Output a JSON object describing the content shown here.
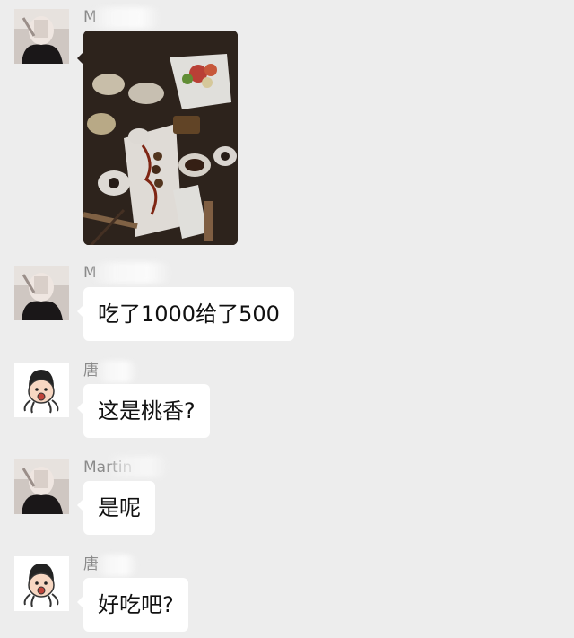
{
  "messages": [
    {
      "sender": "M",
      "type": "image",
      "image_desc": "food-photo"
    },
    {
      "sender": "M",
      "type": "text",
      "text": "吃了1000给了500"
    },
    {
      "sender": "唐",
      "type": "text",
      "text": "这是桃香?"
    },
    {
      "sender": "Martin",
      "type": "text",
      "text": "是呢"
    },
    {
      "sender": "唐",
      "type": "text",
      "text": "好吃吧?"
    }
  ],
  "colors": {
    "background": "#ededed",
    "bubble": "#ffffff",
    "sender_text": "#8a8a8a",
    "message_text": "#111111"
  }
}
